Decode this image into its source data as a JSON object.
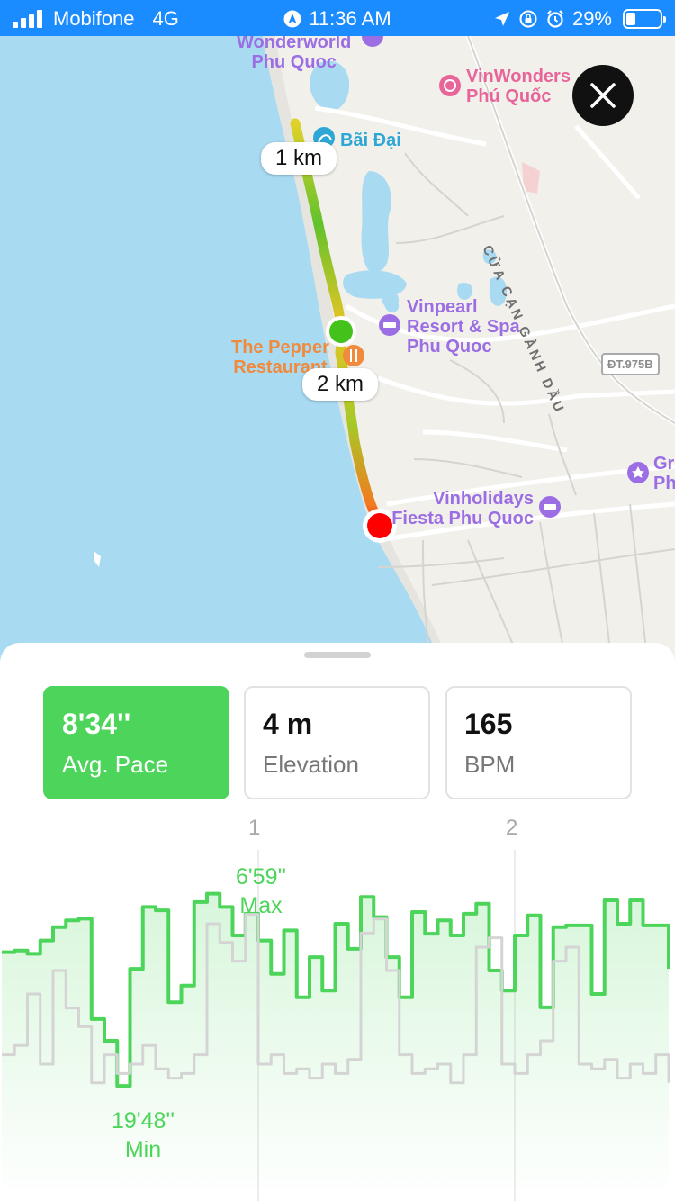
{
  "status_bar": {
    "carrier": "Mobifone",
    "network": "4G",
    "time": "11:36 AM",
    "battery": "29%",
    "battery_level": 0.29
  },
  "map": {
    "pois": {
      "wonderworld": "Wonderworld\nPhu Quoc",
      "vinwonders": "VinWonders\nPhú Quốc",
      "bai_dai": "Bãi Đại",
      "vinpearl": "Vinpearl\nResort & Spa\nPhu Quoc",
      "pepper": "The Pepper\nRestaurant",
      "vinholidays": "Vinholidays\nFiesta Phu Quoc",
      "gr": "Gr\nPh"
    },
    "road_name": "CỬA CẠN GÀNH DẦU",
    "road_shield": "ĐT.975B",
    "markers": {
      "km1": "1 km",
      "km2": "2 km"
    },
    "start_color": "#44c21c",
    "end_color": "#ff0000"
  },
  "stats": [
    {
      "value": "8'34''",
      "label": "Avg. Pace",
      "active": true
    },
    {
      "value": "4 m",
      "label": "Elevation",
      "active": false
    },
    {
      "value": "165",
      "label": "BPM",
      "active": false
    }
  ],
  "chart_data": {
    "type": "line",
    "x_ticks": [
      "1",
      "2"
    ],
    "max_label": [
      "6'59''",
      "Max"
    ],
    "min_label": [
      "19'48''",
      "Min"
    ],
    "series": [
      {
        "color": "#4cd55a",
        "x": [
          0,
          0.05,
          0.1,
          0.15,
          0.2,
          0.25,
          0.3,
          0.35,
          0.4,
          0.45,
          0.5,
          0.55,
          0.6,
          0.65,
          0.7,
          0.75,
          0.8,
          0.85,
          0.9,
          0.95,
          1.0,
          1.05,
          1.1,
          1.15,
          1.2,
          1.25,
          1.3,
          1.35,
          1.4,
          1.45,
          1.5,
          1.55,
          1.6,
          1.65,
          1.7,
          1.75,
          1.8,
          1.85,
          1.9,
          1.95,
          2.0,
          2.05,
          2.1,
          2.15,
          2.2,
          2.25,
          2.3,
          2.35,
          2.4,
          2.45,
          2.5,
          2.55,
          2.6
        ],
        "values": [
          10.5,
          10.4,
          10.6,
          9.8,
          9.0,
          8.6,
          8.5,
          14.5,
          15.8,
          18.5,
          11.5,
          7.8,
          8.0,
          13.5,
          12.5,
          7.5,
          7.0,
          7.8,
          9.5,
          8.2,
          9.8,
          11.8,
          9.2,
          13.2,
          10.8,
          12.8,
          8.8,
          10.3,
          7.2,
          8.4,
          10.8,
          13.2,
          8.1,
          9.4,
          8.6,
          9.5,
          8.2,
          7.6,
          11.6,
          12.8,
          9.5,
          8.3,
          13.8,
          9.0,
          8.9,
          8.9,
          13.0,
          7.4,
          8.8,
          7.4,
          8.9,
          8.9,
          11.5
        ],
        "ylim": [
          6.0,
          20.0
        ]
      },
      {
        "color": "#d4d4d4",
        "x": [
          0,
          0.05,
          0.1,
          0.15,
          0.2,
          0.25,
          0.3,
          0.35,
          0.4,
          0.45,
          0.5,
          0.55,
          0.6,
          0.65,
          0.7,
          0.75,
          0.8,
          0.85,
          0.9,
          0.95,
          1.0,
          1.05,
          1.1,
          1.15,
          1.2,
          1.25,
          1.3,
          1.35,
          1.4,
          1.45,
          1.5,
          1.55,
          1.6,
          1.65,
          1.7,
          1.75,
          1.8,
          1.85,
          1.9,
          1.95,
          2.0,
          2.05,
          2.1,
          2.15,
          2.2,
          2.25,
          2.3,
          2.35,
          2.4,
          2.45,
          2.5,
          2.55,
          2.6
        ],
        "values": [
          1.2,
          1.4,
          2.5,
          1.0,
          3.0,
          2.2,
          1.8,
          0.6,
          1.2,
          0.8,
          1.0,
          1.4,
          0.9,
          0.7,
          0.8,
          1.2,
          4.0,
          3.6,
          3.2,
          4.2,
          1.0,
          1.2,
          0.8,
          0.9,
          0.7,
          1.0,
          0.8,
          1.1,
          3.8,
          4.1,
          3.0,
          1.2,
          0.8,
          0.9,
          1.0,
          0.6,
          1.2,
          3.5,
          3.7,
          1.0,
          0.8,
          1.2,
          1.5,
          3.2,
          3.5,
          1.0,
          0.9,
          1.1,
          0.7,
          1.0,
          0.8,
          1.2,
          0.6
        ],
        "ylim": [
          0.0,
          5.0
        ]
      }
    ]
  }
}
